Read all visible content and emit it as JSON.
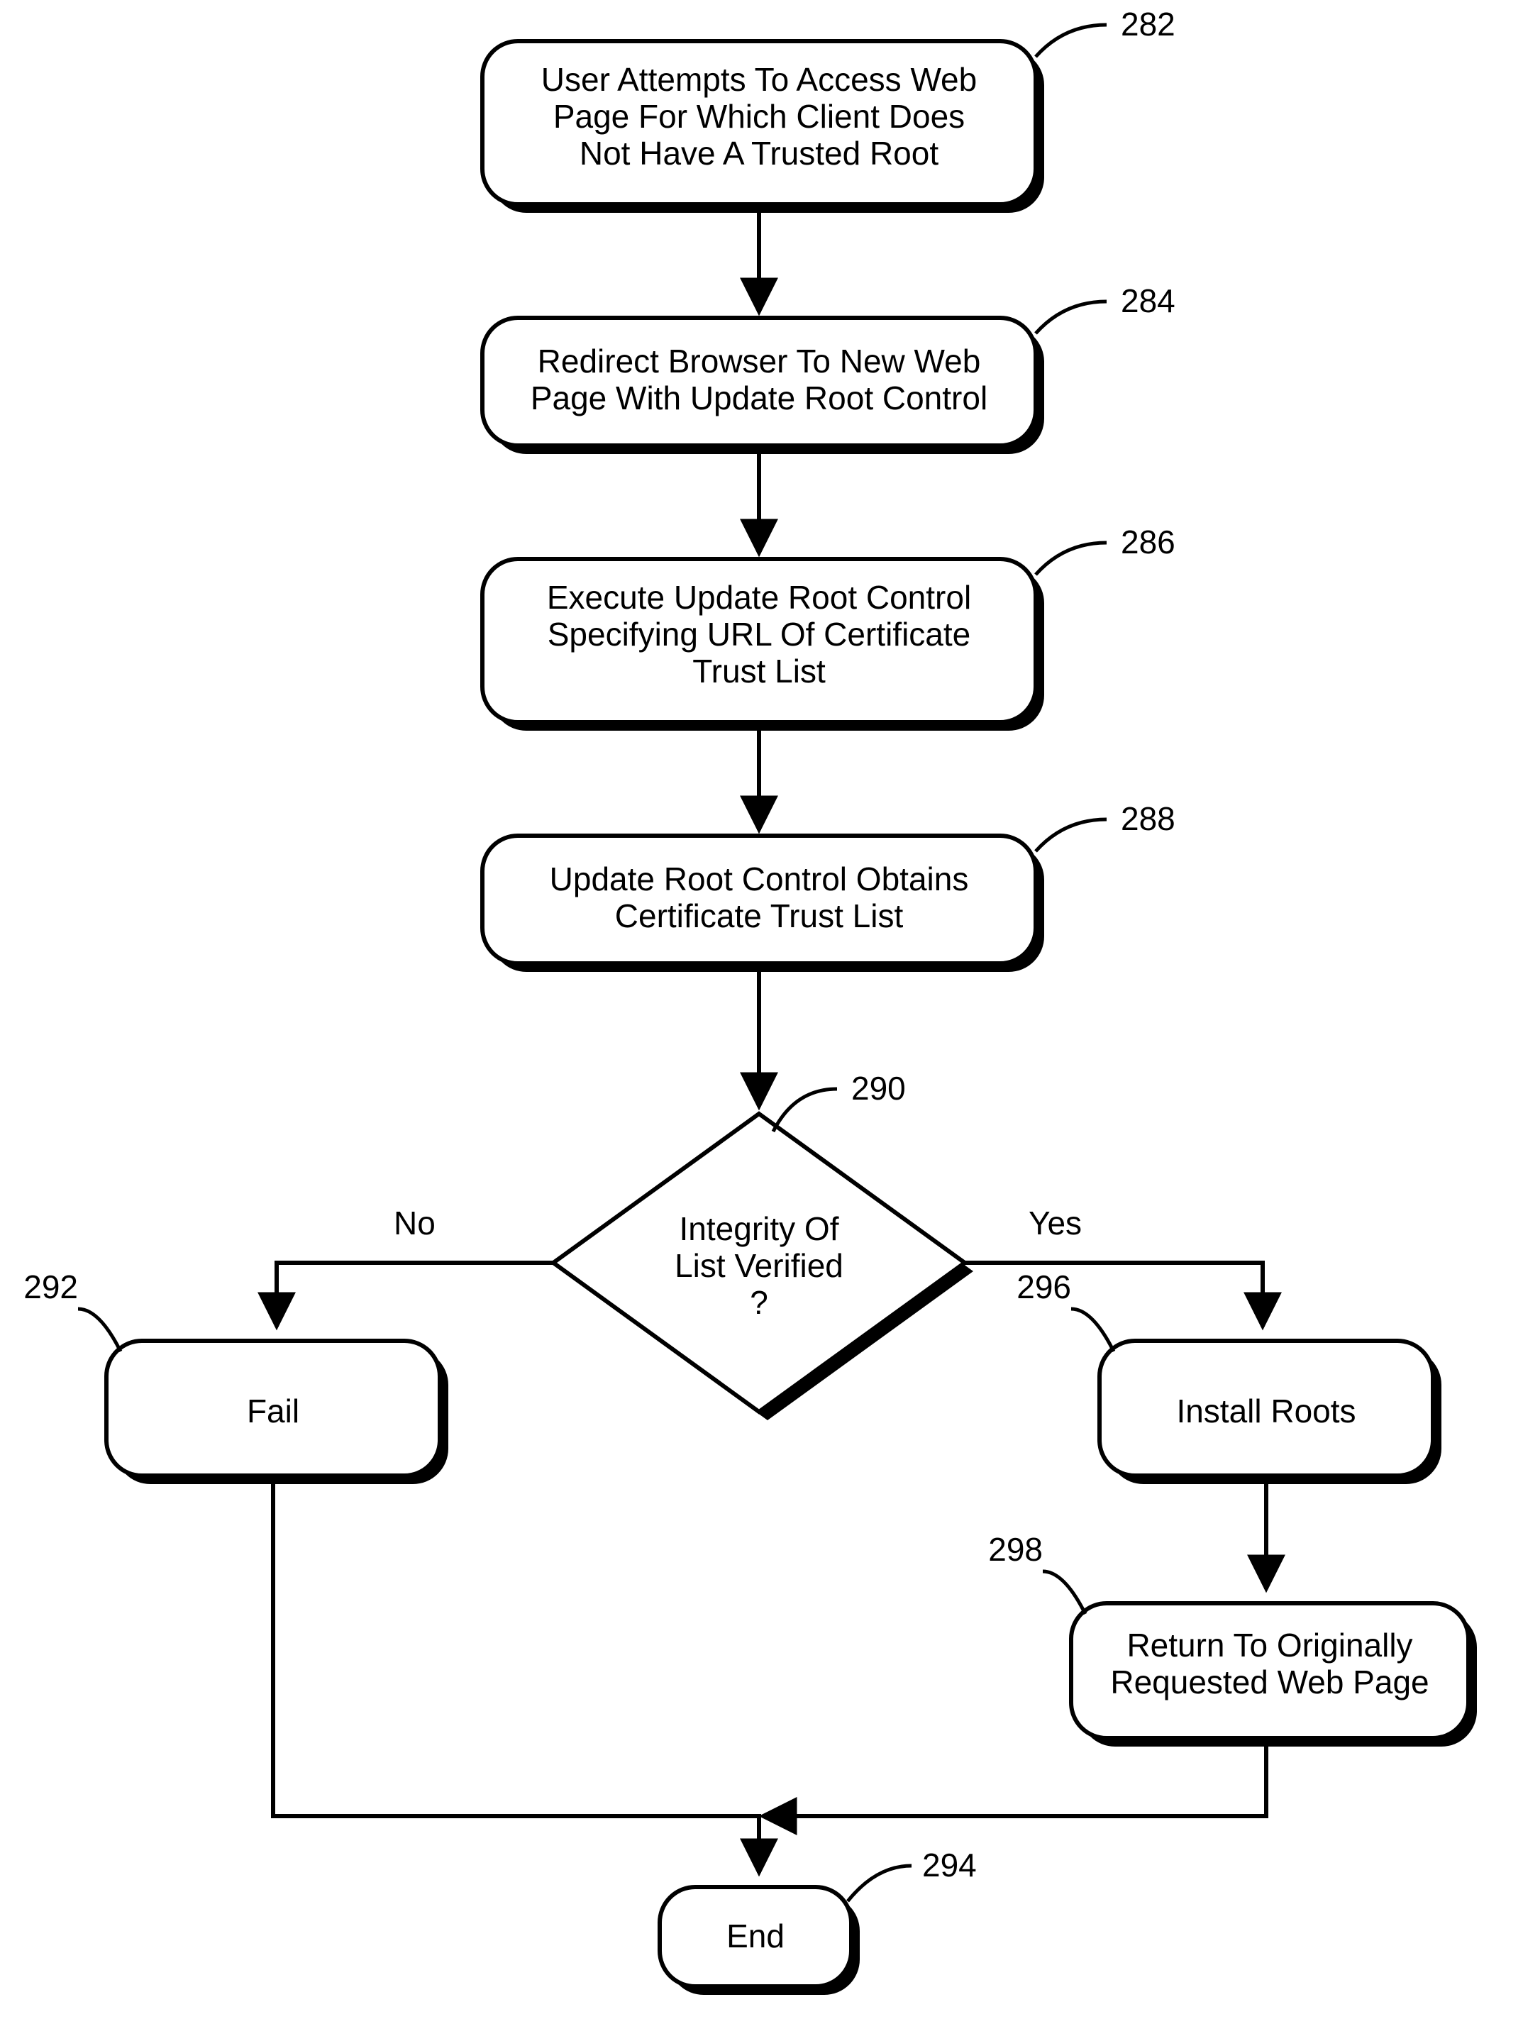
{
  "chart_data": {
    "type": "flowchart",
    "nodes": [
      {
        "id": "282",
        "type": "process",
        "text": "User Attempts To Access Web Page For Which Client Does Not Have A Trusted Root"
      },
      {
        "id": "284",
        "type": "process",
        "text": "Redirect Browser To New Web Page With Update Root Control"
      },
      {
        "id": "286",
        "type": "process",
        "text": "Execute Update Root Control Specifying URL Of Certificate Trust List"
      },
      {
        "id": "288",
        "type": "process",
        "text": "Update Root Control Obtains Certificate Trust List"
      },
      {
        "id": "290",
        "type": "decision",
        "text": "Integrity Of List Verified ?"
      },
      {
        "id": "292",
        "type": "process",
        "text": "Fail"
      },
      {
        "id": "296",
        "type": "process",
        "text": "Install Roots"
      },
      {
        "id": "298",
        "type": "process",
        "text": "Return To Originally Requested Web Page"
      },
      {
        "id": "294",
        "type": "terminal",
        "text": "End"
      }
    ],
    "edges": [
      {
        "from": "282",
        "to": "284"
      },
      {
        "from": "284",
        "to": "286"
      },
      {
        "from": "286",
        "to": "288"
      },
      {
        "from": "288",
        "to": "290"
      },
      {
        "from": "290",
        "to": "292",
        "label": "No"
      },
      {
        "from": "290",
        "to": "296",
        "label": "Yes"
      },
      {
        "from": "292",
        "to": "294"
      },
      {
        "from": "296",
        "to": "298"
      },
      {
        "from": "298",
        "to": "294"
      }
    ]
  },
  "nodes": {
    "n282": {
      "ref": "282",
      "l1": "User Attempts To Access Web",
      "l2": "Page For Which Client Does",
      "l3": "Not Have A Trusted Root"
    },
    "n284": {
      "ref": "284",
      "l1": "Redirect Browser To New Web",
      "l2": "Page With Update Root Control"
    },
    "n286": {
      "ref": "286",
      "l1": "Execute Update Root Control",
      "l2": "Specifying URL Of Certificate",
      "l3": "Trust List"
    },
    "n288": {
      "ref": "288",
      "l1": "Update Root Control Obtains",
      "l2": "Certificate Trust List"
    },
    "n290": {
      "ref": "290",
      "l1": "Integrity Of",
      "l2": "List Verified",
      "l3": "?"
    },
    "n292": {
      "ref": "292",
      "l1": "Fail"
    },
    "n296": {
      "ref": "296",
      "l1": "Install Roots"
    },
    "n298": {
      "ref": "298",
      "l1": "Return To Originally",
      "l2": "Requested Web Page"
    },
    "n294": {
      "ref": "294",
      "l1": "End"
    }
  },
  "labels": {
    "no": "No",
    "yes": "Yes"
  }
}
